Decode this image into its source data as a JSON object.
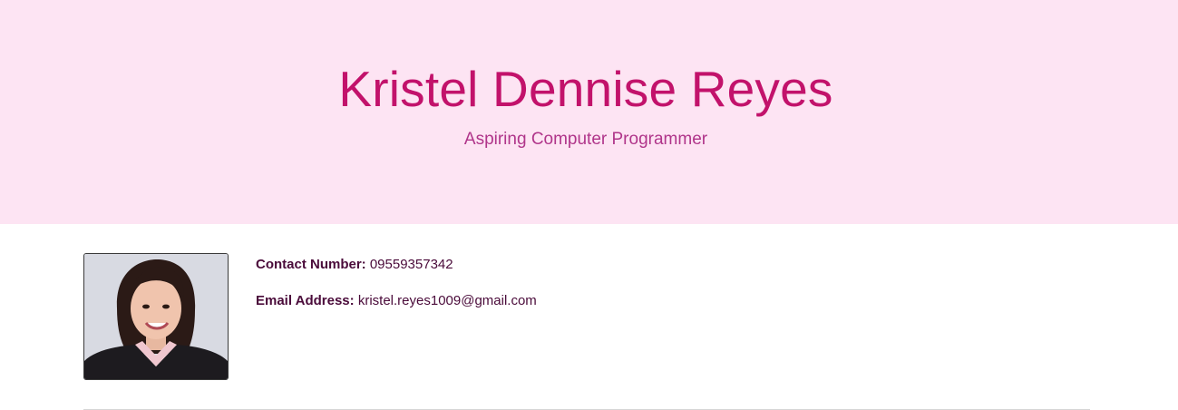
{
  "header": {
    "name": "Kristel Dennise Reyes",
    "subtitle": "Aspiring Computer Programmer"
  },
  "profile": {
    "photo_icon": "profile-photo",
    "contact_label": "Contact Number:",
    "contact_value": "09559357342",
    "email_label": "Email Address:",
    "email_value": "kristel.reyes1009@gmail.com"
  },
  "colors": {
    "hero_bg": "#fde4f3",
    "name_color": "#c2126b",
    "subtitle_color": "#b0358a",
    "label_color": "#4a0b3a"
  }
}
